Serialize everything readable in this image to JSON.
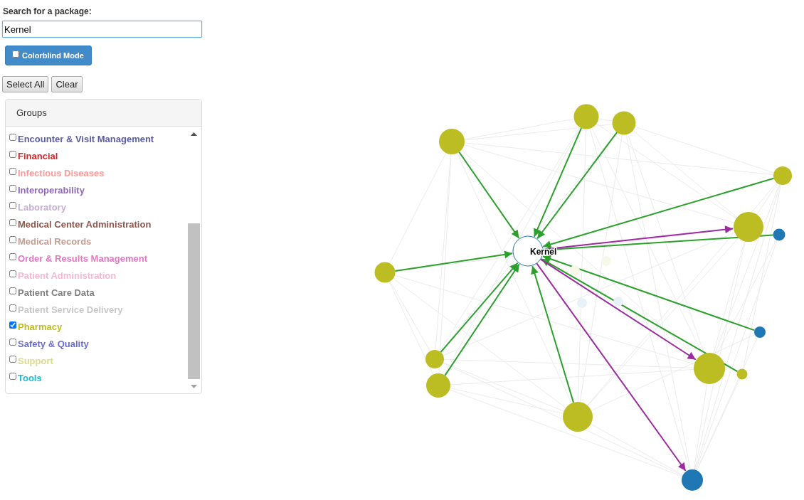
{
  "search": {
    "label": "Search for a package:",
    "value": "Kernel"
  },
  "colorblind_toggle": {
    "label": "Colorblind Mode",
    "checked": false
  },
  "buttons": [
    "Select All",
    "Clear"
  ],
  "groups_panel": {
    "title": "Groups",
    "items": [
      {
        "label": "Encounter & Visit Management",
        "color": "#5b5ca6",
        "checked": false
      },
      {
        "label": "Financial",
        "color": "#d62728",
        "checked": false
      },
      {
        "label": "Infectious Diseases",
        "color": "#ff9896",
        "checked": false
      },
      {
        "label": "Interoperability",
        "color": "#9467bd",
        "checked": false
      },
      {
        "label": "Laboratory",
        "color": "#c5b0d5",
        "checked": false
      },
      {
        "label": "Medical Center Administration",
        "color": "#8c564b",
        "checked": false
      },
      {
        "label": "Medical Records",
        "color": "#c49c94",
        "checked": false
      },
      {
        "label": "Order & Results Management",
        "color": "#e377c2",
        "checked": false
      },
      {
        "label": "Patient Administration",
        "color": "#f7b6d2",
        "checked": false
      },
      {
        "label": "Patient Care Data",
        "color": "#7f7f7f",
        "checked": false
      },
      {
        "label": "Patient Service Delivery",
        "color": "#c7c7c7",
        "checked": false
      },
      {
        "label": "Pharmacy",
        "color": "#bcbd22",
        "checked": true
      },
      {
        "label": "Safety & Quality",
        "color": "#6b6ecf",
        "checked": false
      },
      {
        "label": "Support",
        "color": "#dbdb8d",
        "checked": false
      },
      {
        "label": "Tools",
        "color": "#17becf",
        "checked": false
      }
    ]
  },
  "graph": {
    "focus_node": {
      "label": "Kernel",
      "color": "#1f77b4"
    },
    "nodes_linked_to_focus": [
      {
        "color": "#bcbd22"
      },
      {
        "color": "#bcbd22"
      },
      {
        "color": "#bcbd22"
      },
      {
        "color": "#bcbd22"
      },
      {
        "color": "#1f77b4"
      },
      {
        "color": "#bcbd22"
      },
      {
        "color": "#1f77b4"
      },
      {
        "color": "#bcbd22"
      },
      {
        "color": "#bcbd22"
      },
      {
        "color": "#bcbd22"
      },
      {
        "color": "#bcbd22"
      }
    ],
    "nodes_linked_from_focus": [
      {
        "color": "#bcbd22"
      },
      {
        "color": "#bcbd22"
      },
      {
        "color": "#1f77b4"
      }
    ],
    "unlinked_nodes": [
      {
        "color": "#f8f8e9"
      },
      {
        "color": "#f8f8e9"
      },
      {
        "color": "#e9f1f8"
      },
      {
        "color": "#e9f1f8"
      }
    ]
  }
}
